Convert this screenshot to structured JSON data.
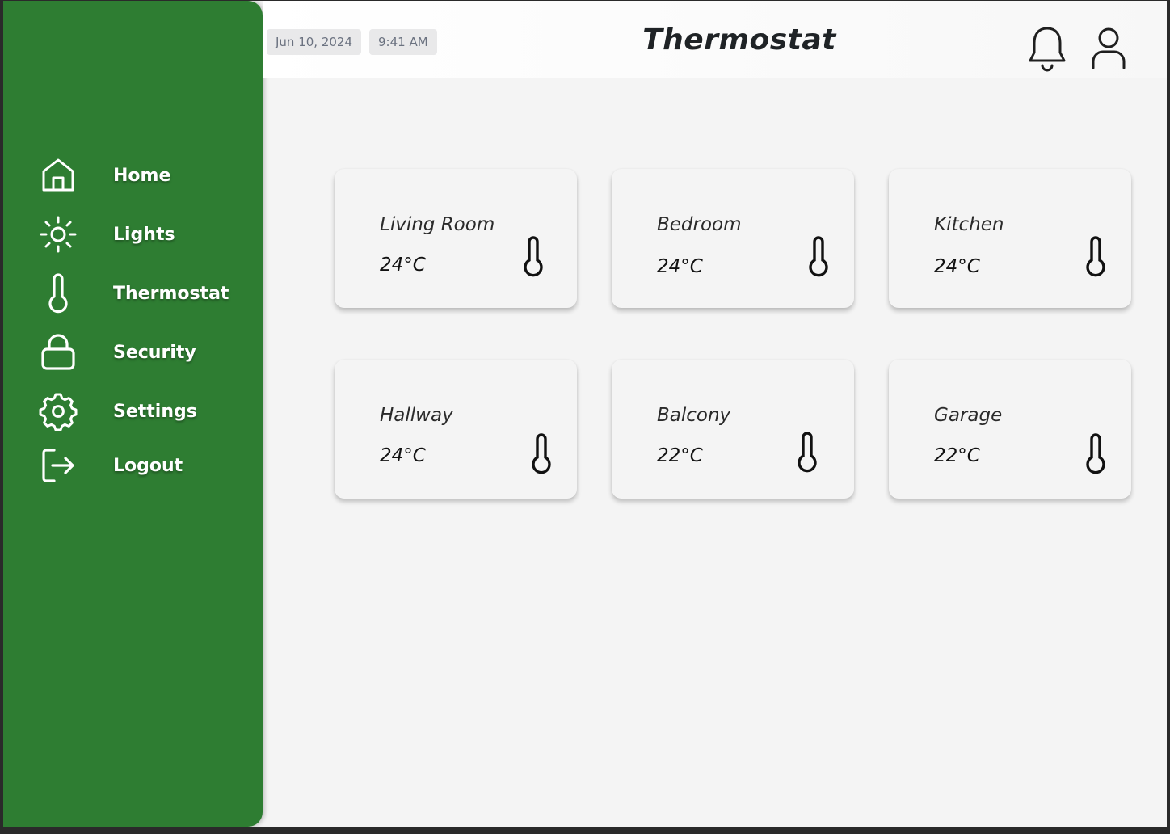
{
  "header": {
    "date": "Jun 10, 2024",
    "time": "9:41 AM",
    "title": "Thermostat",
    "icons": [
      "bell-icon",
      "user-icon"
    ]
  },
  "sidebar": {
    "items": [
      {
        "label": "Home",
        "icon": "home-icon"
      },
      {
        "label": "Lights",
        "icon": "sun-icon"
      },
      {
        "label": "Thermostat",
        "icon": "thermometer-icon"
      },
      {
        "label": "Security",
        "icon": "lock-icon"
      },
      {
        "label": "Settings",
        "icon": "gear-icon"
      },
      {
        "label": "Logout",
        "icon": "logout-icon"
      }
    ]
  },
  "rooms": [
    {
      "name": "Living Room",
      "temperature": "24°C"
    },
    {
      "name": "Bedroom",
      "temperature": "24°C"
    },
    {
      "name": "Kitchen",
      "temperature": "24°C"
    },
    {
      "name": "Hallway",
      "temperature": "24°C"
    },
    {
      "name": "Balcony",
      "temperature": "22°C"
    },
    {
      "name": "Garage",
      "temperature": "22°C"
    }
  ],
  "colors": {
    "sidebar": "#2e7d32",
    "background": "#f4f4f4",
    "text": "#1f2326"
  }
}
